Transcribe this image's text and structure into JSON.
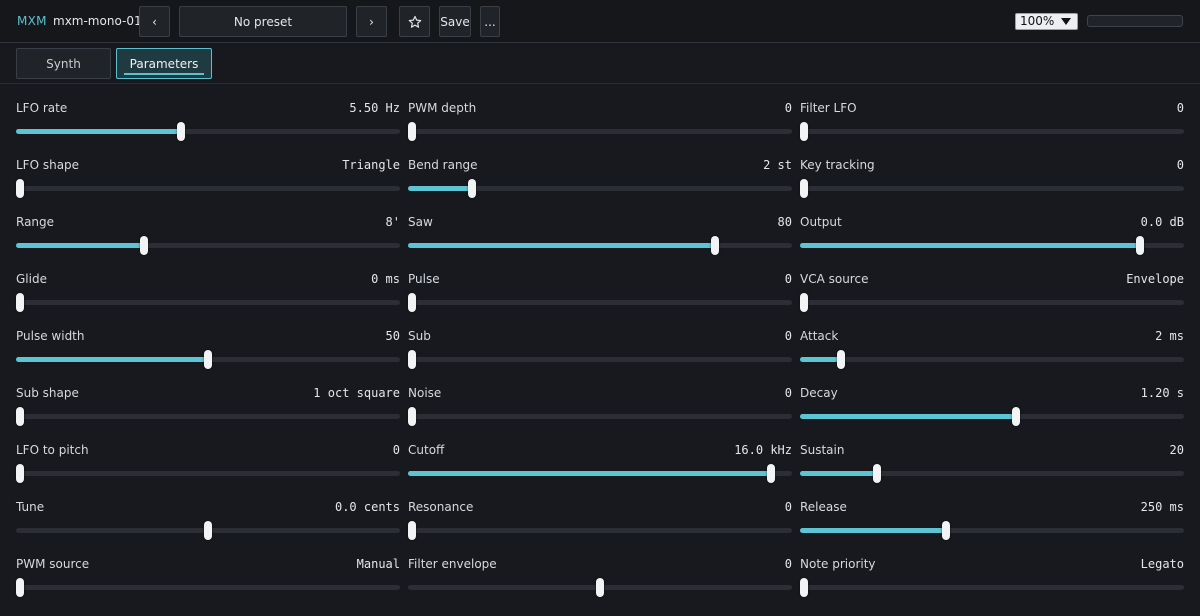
{
  "header": {
    "brand": "MXM",
    "plugin_name": "mxm-mono-01",
    "prev_label": "‹",
    "preset_name": "No preset",
    "next_label": "›",
    "favorite_icon": "star-icon",
    "save_label": "Save",
    "more_label": "...",
    "zoom": "100%"
  },
  "tabs": [
    {
      "label": "Synth",
      "active": false
    },
    {
      "label": "Parameters",
      "active": true
    }
  ],
  "accent_color": "#5cc4d3",
  "params": [
    {
      "label": "LFO rate",
      "value": "5.50 Hz",
      "level": 0.43
    },
    {
      "label": "PWM depth",
      "value": "0",
      "level": 0
    },
    {
      "label": "Filter LFO",
      "value": "0",
      "level": 0
    },
    {
      "label": "LFO shape",
      "value": "Triangle",
      "level": 0
    },
    {
      "label": "Bend range",
      "value": "2 st",
      "level": 0.167
    },
    {
      "label": "Key tracking",
      "value": "0",
      "level": 0
    },
    {
      "label": "Range",
      "value": "8'",
      "level": 0.333
    },
    {
      "label": "Saw",
      "value": "80",
      "level": 0.8
    },
    {
      "label": "Output",
      "value": "0.0 dB",
      "level": 0.885
    },
    {
      "label": "Glide",
      "value": "0 ms",
      "level": 0
    },
    {
      "label": "Pulse",
      "value": "0",
      "level": 0
    },
    {
      "label": "VCA source",
      "value": "Envelope",
      "level": 0
    },
    {
      "label": "Pulse width",
      "value": "50",
      "level": 0.5
    },
    {
      "label": "Sub",
      "value": "0",
      "level": 0
    },
    {
      "label": "Attack",
      "value": "2 ms",
      "level": 0.107
    },
    {
      "label": "Sub shape",
      "value": "1 oct square",
      "level": 0
    },
    {
      "label": "Noise",
      "value": "0",
      "level": 0
    },
    {
      "label": "Decay",
      "value": "1.20 s",
      "level": 0.562
    },
    {
      "label": "LFO to pitch",
      "value": "0",
      "level": 0
    },
    {
      "label": "Cutoff",
      "value": "16.0 kHz",
      "level": 0.946
    },
    {
      "label": "Sustain",
      "value": "20",
      "level": 0.2
    },
    {
      "label": "Tune",
      "value": "0.0 cents",
      "level": 0.5,
      "fill": false
    },
    {
      "label": "Resonance",
      "value": "0",
      "level": 0
    },
    {
      "label": "Release",
      "value": "250 ms",
      "level": 0.381
    },
    {
      "label": "PWM source",
      "value": "Manual",
      "level": 0
    },
    {
      "label": "Filter envelope",
      "value": "0",
      "level": 0.5,
      "fill": false
    },
    {
      "label": "Note priority",
      "value": "Legato",
      "level": 0
    }
  ]
}
